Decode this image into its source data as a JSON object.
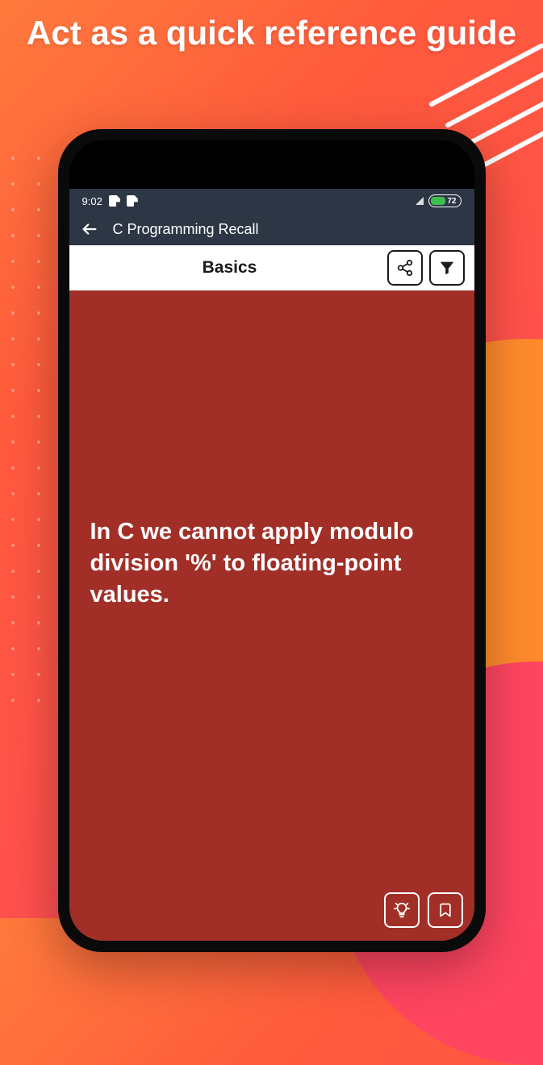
{
  "marketing": {
    "headline": "Act as a quick reference guide"
  },
  "statusbar": {
    "time": "9:02",
    "battery": "72"
  },
  "appbar": {
    "title": "C Programming Recall"
  },
  "toolbar": {
    "category": "Basics"
  },
  "card": {
    "fact": "In C we cannot apply modulo division '%' to floating-point values."
  }
}
